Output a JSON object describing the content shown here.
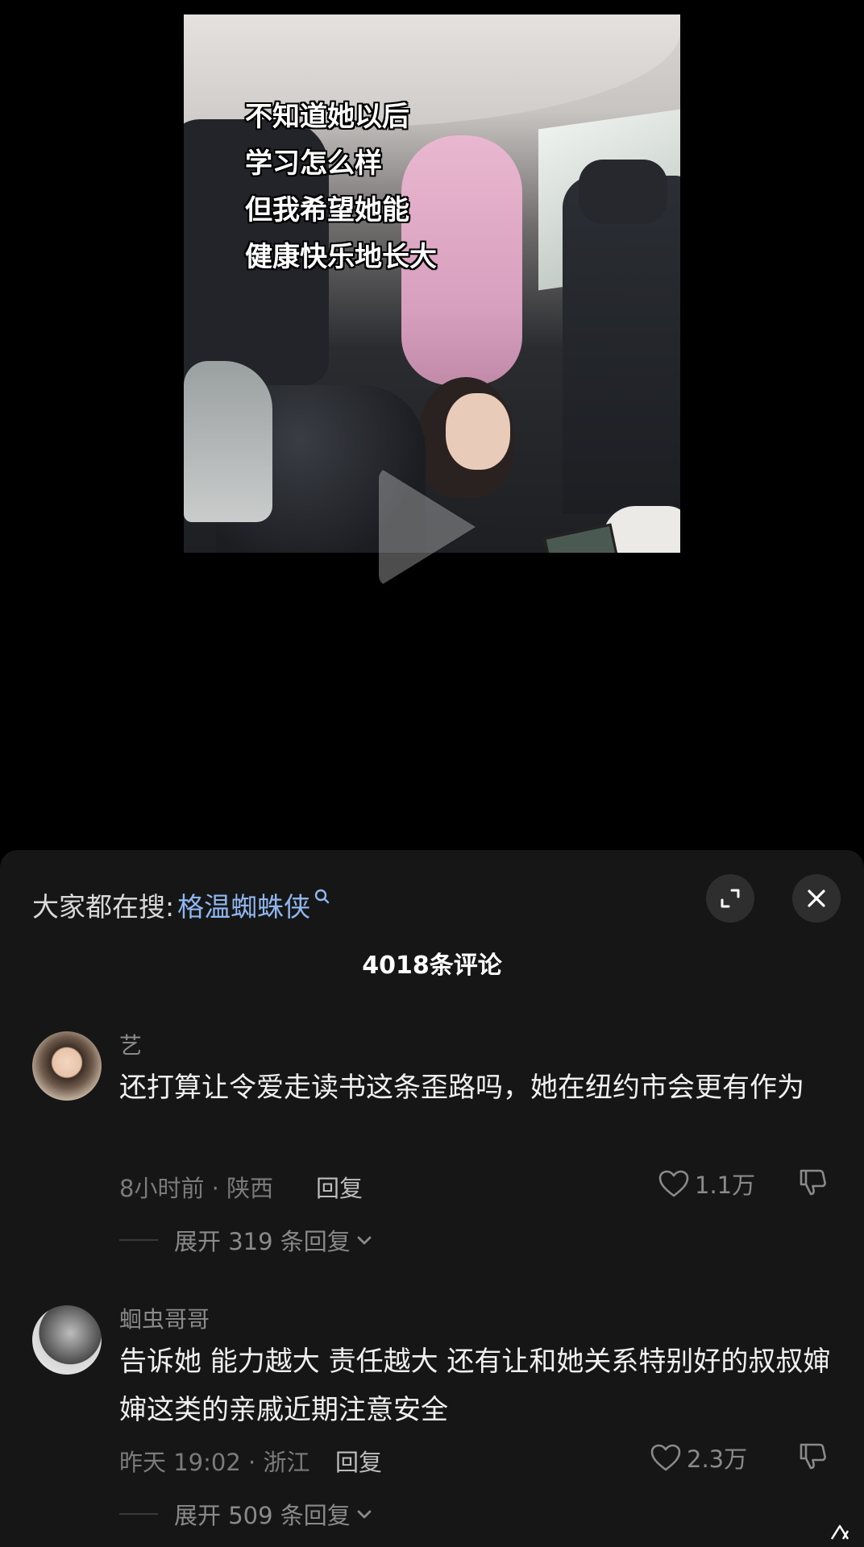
{
  "video": {
    "caption_lines": [
      "不知道她以后",
      "学习怎么样",
      "但我希望她能",
      "健康快乐地长大"
    ]
  },
  "panel": {
    "search_prefix": "大家都在搜:",
    "search_term": "格温蜘蛛侠",
    "comment_count": "4018条评论"
  },
  "comments": [
    {
      "username": "艺",
      "text": "还打算让令爱走读书这条歪路吗，她在纽约市会更有作为",
      "time": "8小时前",
      "location": "陕西",
      "reply_label": "回复",
      "likes": "1.1万",
      "expand_label": "展开 319 条回复"
    },
    {
      "username": "蛔虫哥哥",
      "text": "告诉她 能力越大 责任越大 还有让和她关系特别好的叔叔婶婶这类的亲戚近期注意安全",
      "time": "昨天 19:02",
      "location": "浙江",
      "reply_label": "回复",
      "likes": "2.3万",
      "expand_label": "展开 509 条回复"
    }
  ],
  "icons": {
    "search": "search-icon",
    "expand": "expand-icon",
    "close": "close-icon",
    "like": "heart-icon",
    "dislike": "thumbs-down-icon",
    "chevron": "chevron-down-icon"
  },
  "colors": {
    "panel_bg": "#161616",
    "search_term": "#8fb6ee",
    "text_primary": "#f0f0f0",
    "text_secondary": "#8a8a8a"
  }
}
